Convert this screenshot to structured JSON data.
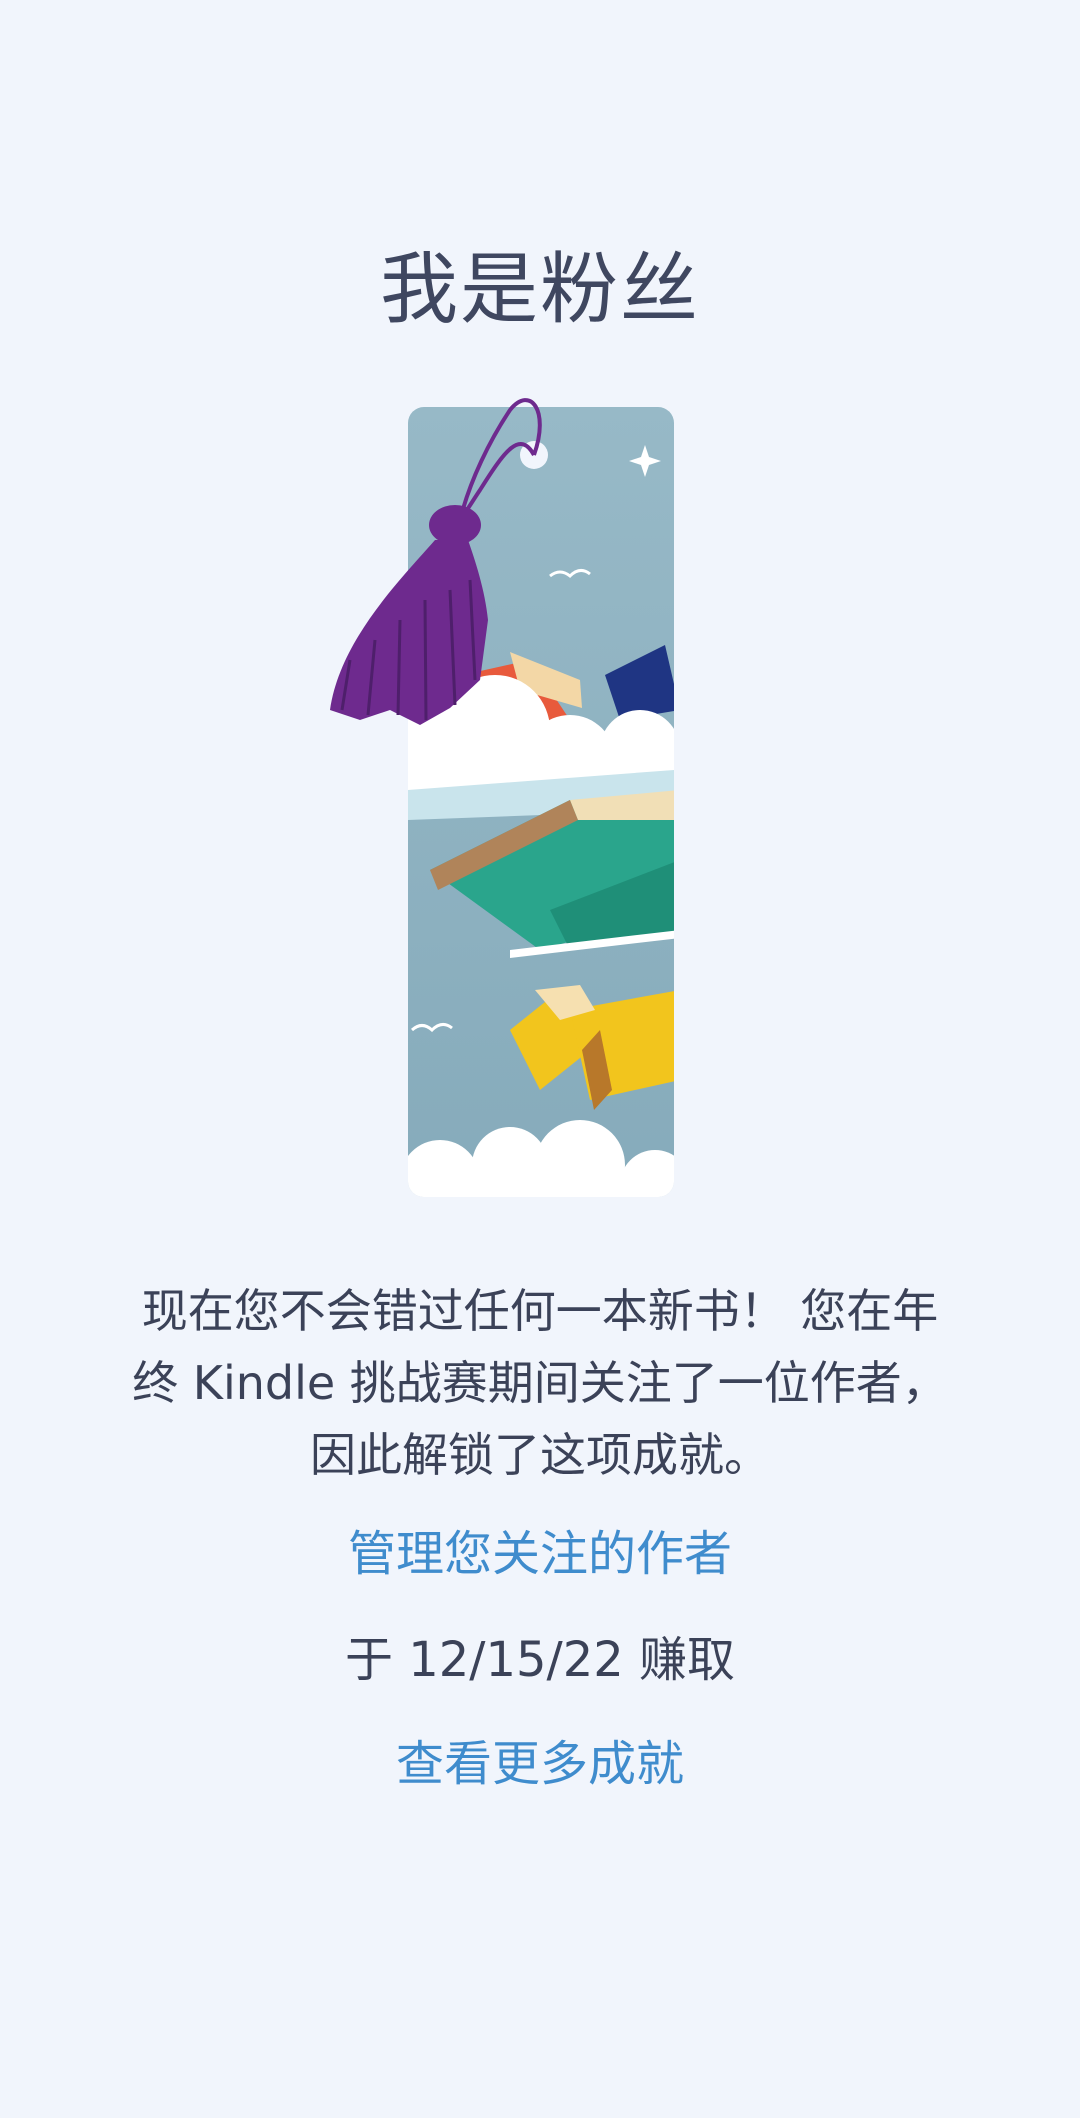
{
  "achievement": {
    "title": "我是粉丝",
    "description": "现在您不会错过任何一本新书！ 您在年终 Kindle 挑战赛期间关注了一位作者，因此解锁了这项成就。",
    "manage_link": "管理您关注的作者",
    "earned_text": "于 12/15/22 赚取",
    "more_link": "查看更多成就"
  },
  "colors": {
    "background": "#f1f5fc",
    "title": "#3f4760",
    "body_text": "#3b4258",
    "link": "#3f8ccd",
    "bookmark_sky": "#8fb3c2",
    "tassel": "#6e2a8e",
    "book_teal": "#2aa58c",
    "book_yellow": "#f2c51d",
    "book_red": "#e85a3c",
    "book_navy": "#1f3583"
  }
}
